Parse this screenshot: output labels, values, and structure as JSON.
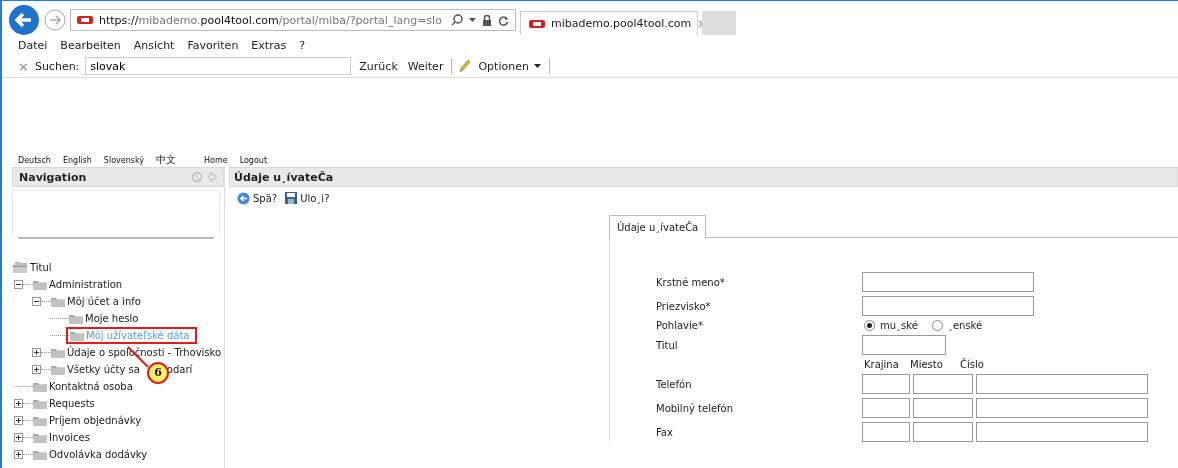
{
  "browser": {
    "url_parts": [
      {
        "text": "https://",
        "emphasis": true
      },
      {
        "text": "mibademo.",
        "emphasis": false
      },
      {
        "text": "pool4tool.com",
        "emphasis": true
      },
      {
        "text": "/portal/miba/?portal_lang=slo",
        "emphasis": false
      }
    ],
    "tab": {
      "title": "mibademo.pool4tool.com",
      "close": "×"
    },
    "menu": [
      "Datei",
      "Bearbeiten",
      "Ansicht",
      "Favoriten",
      "Extras",
      "?"
    ],
    "find_bar": {
      "close": "×",
      "label": "Suchen:",
      "value": "slovak",
      "buttons": [
        "Zurück",
        "Weiter"
      ],
      "options": "Optionen"
    }
  },
  "top_links": [
    "Deutsch",
    "English",
    "Slovenský",
    "中文",
    "Home",
    "Logout"
  ],
  "navigation": {
    "title": "Navigation",
    "tree": [
      {
        "label": "Titul",
        "kind": "root",
        "selected": false,
        "children": [
          {
            "label": "Administration",
            "kind": "folder",
            "expanded": true,
            "selected": false,
            "children": [
              {
                "label": "Môj účet a info",
                "kind": "folder",
                "expanded": true,
                "selected": false,
                "children": [
                  {
                    "label": "Moje heslo",
                    "kind": "leaf",
                    "selected": false
                  },
                  {
                    "label": "Môj užívateľské dáta",
                    "kind": "leaf",
                    "selected": true,
                    "callout": "6"
                  }
                ]
              },
              {
                "label": "Údaje o spoločnosti - Trhovisko",
                "kind": "folder",
                "expanded": false,
                "selected": false
              },
              {
                "label": "Všetky účty sa",
                "label_tail": "odarí",
                "kind": "folder",
                "expanded": false,
                "selected": false
              }
            ]
          },
          {
            "label": "Kontaktná osoba",
            "kind": "leaf",
            "selected": false
          },
          {
            "label": "Requests",
            "kind": "folder",
            "expanded": false,
            "selected": false
          },
          {
            "label": "Príjem objednávky",
            "kind": "folder",
            "expanded": false,
            "selected": false
          },
          {
            "label": "Invoices",
            "kind": "folder",
            "expanded": false,
            "selected": false
          },
          {
            "label": "Odvolávka dodávky",
            "kind": "folder",
            "expanded": false,
            "selected": false
          }
        ]
      }
    ]
  },
  "main": {
    "title": "Údaje u¸ívateČa",
    "toolbar": [
      {
        "kind": "back",
        "label": "Spä?"
      },
      {
        "kind": "save",
        "label": "Ulo¸i?"
      }
    ],
    "tabs": [
      {
        "label": "Údaje u¸ívateČa",
        "selected": true
      }
    ],
    "form": [
      {
        "kind": "text",
        "label": "Krstné meno*"
      },
      {
        "kind": "text",
        "label": "Priezvisko*"
      },
      {
        "kind": "radio",
        "label": "Pohlavie*",
        "options": [
          {
            "label": "mu¸ské",
            "selected": true
          },
          {
            "label": "¸enské",
            "selected": false
          }
        ]
      },
      {
        "kind": "short_text",
        "label": "Titul"
      },
      {
        "kind": "heading",
        "columns": [
          "Krajina",
          "Miesto",
          "Číslo"
        ]
      },
      {
        "kind": "phone",
        "label": "Telefón"
      },
      {
        "kind": "phone",
        "label": "Mobilný telefón"
      },
      {
        "kind": "phone",
        "label": "Fax"
      }
    ]
  }
}
